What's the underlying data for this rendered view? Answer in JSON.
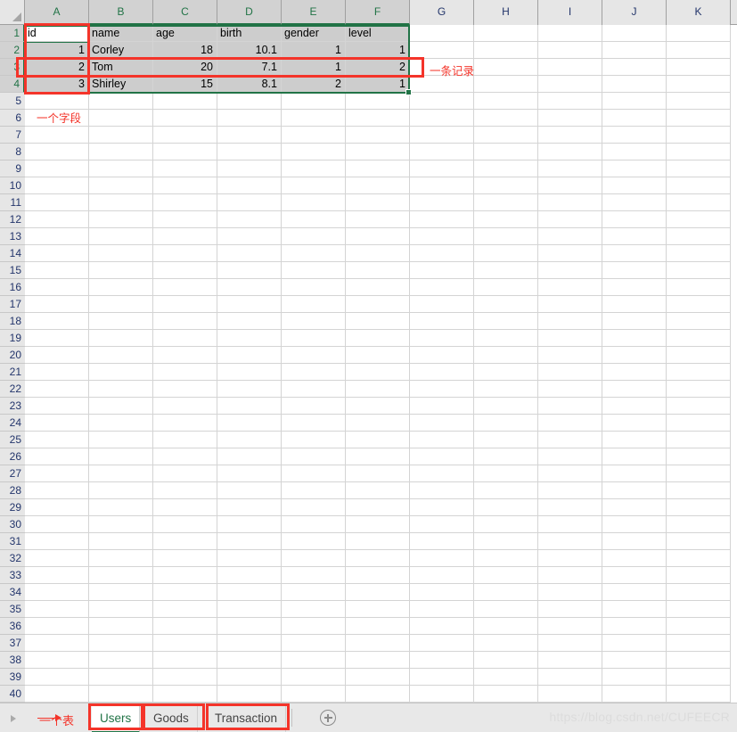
{
  "app": {
    "type": "spreadsheet",
    "active_cell": "A1",
    "selection_range": "A1:F4",
    "watermark": "https://blog.csdn.net/CUFEECR",
    "colors": {
      "accent_green": "#217346",
      "annotation_red": "#f4342a",
      "selection_fill": "#cdcdcd",
      "header_fill": "#e6e6e6",
      "header_fill_selected": "#d2d2d2"
    }
  },
  "grid": {
    "column_headers": [
      "A",
      "B",
      "C",
      "D",
      "E",
      "F",
      "G",
      "H",
      "I",
      "J",
      "K"
    ],
    "selected_columns": [
      "A",
      "B",
      "C",
      "D",
      "E",
      "F"
    ],
    "row_headers": [
      1,
      2,
      3,
      4,
      5,
      6,
      7,
      8,
      9,
      10,
      11,
      12,
      13,
      14,
      15,
      16,
      17,
      18,
      19,
      20,
      21,
      22,
      23,
      24,
      25,
      26,
      27,
      28,
      29,
      30,
      31,
      32,
      33,
      34,
      35,
      36,
      37,
      38,
      39,
      40
    ],
    "selected_rows": [
      1,
      2,
      3,
      4
    ],
    "select_all_icon": "select-all-triangle-icon"
  },
  "sheet_data": {
    "headers": [
      "id",
      "name",
      "age",
      "birth",
      "gender",
      "level"
    ],
    "rows": [
      {
        "id": "1",
        "name": "Corley",
        "age": "18",
        "birth": "10.1",
        "gender": "1",
        "level": "1"
      },
      {
        "id": "2",
        "name": "Tom",
        "age": "20",
        "birth": "7.1",
        "gender": "1",
        "level": "2"
      },
      {
        "id": "3",
        "name": "Shirley",
        "age": "15",
        "birth": "8.1",
        "gender": "2",
        "level": "1"
      }
    ]
  },
  "annotations": {
    "field": {
      "label": "一个字段",
      "target": "column A (A1:A4)"
    },
    "record": {
      "label": "一条记录",
      "target": "row 3 (A3:F3)"
    },
    "table": {
      "label": "一个表",
      "target": "sheet tabs"
    }
  },
  "tabbar": {
    "nav_prev_icon": "chevron-left-icon",
    "tabs": [
      {
        "label": "Users",
        "active": true
      },
      {
        "label": "Goods",
        "active": false
      },
      {
        "label": "Transaction",
        "active": false
      }
    ],
    "add_sheet_icon": "plus-circle-icon"
  }
}
